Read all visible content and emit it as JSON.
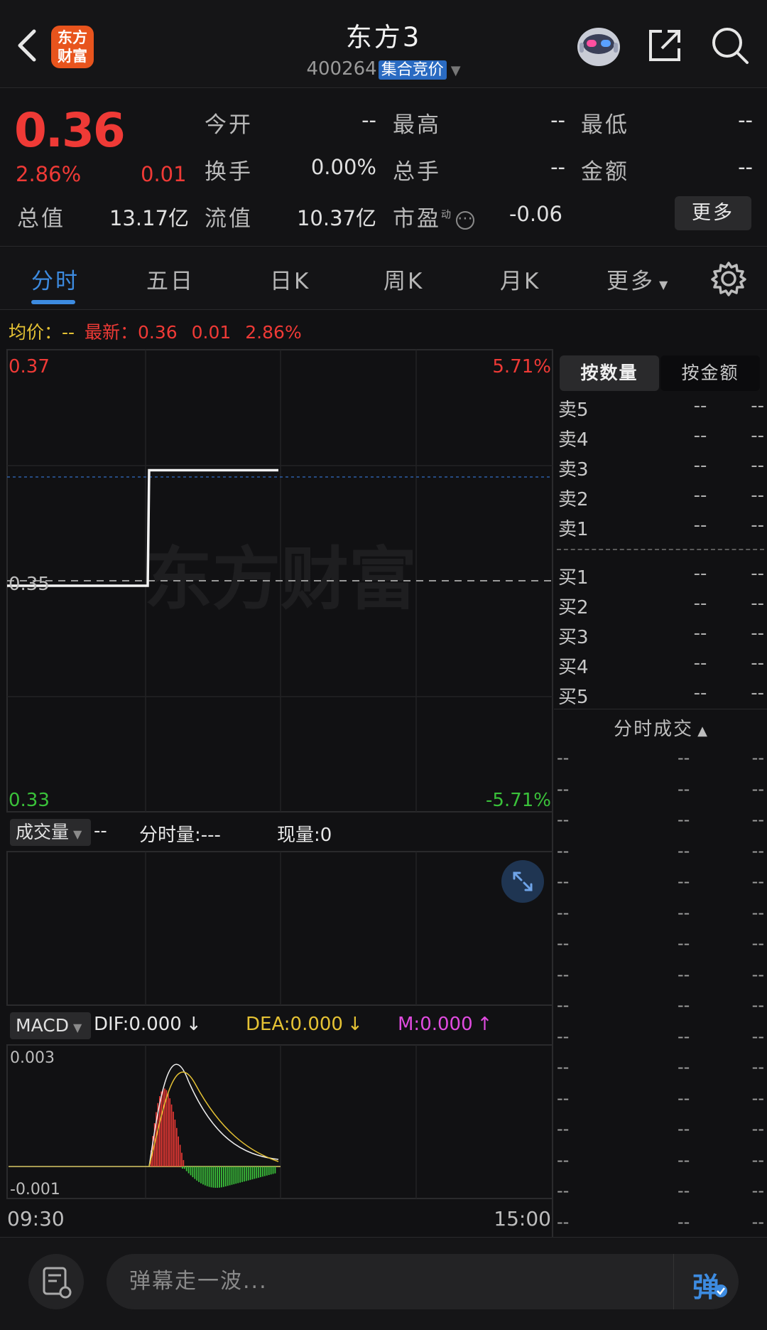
{
  "header": {
    "logo_line1": "东方",
    "logo_line2": "财富",
    "title": "东方3",
    "code": "400264",
    "status_badge": "集合竞价"
  },
  "quote": {
    "price": "0.36",
    "pct": "2.86%",
    "change": "0.01",
    "open_label": "今开",
    "open_value": "--",
    "high_label": "最高",
    "high_value": "--",
    "low_label": "最低",
    "low_value": "--",
    "turnover_label": "换手",
    "turnover_value": "0.00%",
    "volume_label": "总手",
    "volume_value": "--",
    "amount_label": "金额",
    "amount_value": "--",
    "mktcap_label": "总值",
    "mktcap_value": "13.17亿",
    "float_label": "流值",
    "float_value": "10.37亿",
    "pe_label": "市盈",
    "pe_sup": "动",
    "pe_value": "-0.06",
    "more_label": "更多"
  },
  "tabs": [
    {
      "label": "分时",
      "active": true
    },
    {
      "label": "五日",
      "active": false
    },
    {
      "label": "日K",
      "active": false
    },
    {
      "label": "周K",
      "active": false
    },
    {
      "label": "月K",
      "active": false
    },
    {
      "label": "更多",
      "active": false
    }
  ],
  "info_line": {
    "avg_label": "均价：",
    "avg_value": "--",
    "latest_label": "最新：",
    "latest_price": "0.36",
    "latest_change": "0.01",
    "latest_pct": "2.86%"
  },
  "chart": {
    "y_top": "0.37",
    "y_mid": "0.35",
    "y_bottom": "0.33",
    "pct_top": "5.71%",
    "pct_bottom": "-5.71%",
    "watermark": "东方财富",
    "x_start": "09:30",
    "x_end": "15:00"
  },
  "chart_data": {
    "type": "line",
    "ylim": [
      0.33,
      0.37
    ],
    "prev_close": 0.35,
    "x_range": [
      "09:30",
      "15:00"
    ],
    "series": [
      {
        "values": [
          0.35,
          0.35,
          0.36,
          0.36
        ]
      }
    ]
  },
  "volume": {
    "select_label": "成交量",
    "vol_value": "--",
    "period_label": "分时量:",
    "period_value": "---",
    "current_label": "现量:",
    "current_value": "0"
  },
  "macd": {
    "select_label": "MACD",
    "dif": "DIF:0.000",
    "dea": "DEA:0.000",
    "m": "M:0.000",
    "y_top": "0.003",
    "y_bottom": "-0.001"
  },
  "orderbook": {
    "tab_qty": "按数量",
    "tab_amt": "按金额",
    "sell": [
      {
        "label": "卖5",
        "v1": "--",
        "v2": "--"
      },
      {
        "label": "卖4",
        "v1": "--",
        "v2": "--"
      },
      {
        "label": "卖3",
        "v1": "--",
        "v2": "--"
      },
      {
        "label": "卖2",
        "v1": "--",
        "v2": "--"
      },
      {
        "label": "卖1",
        "v1": "--",
        "v2": "--"
      }
    ],
    "buy": [
      {
        "label": "买1",
        "v1": "--",
        "v2": "--"
      },
      {
        "label": "买2",
        "v1": "--",
        "v2": "--"
      },
      {
        "label": "买3",
        "v1": "--",
        "v2": "--"
      },
      {
        "label": "买4",
        "v1": "--",
        "v2": "--"
      },
      {
        "label": "买5",
        "v1": "--",
        "v2": "--"
      }
    ],
    "ticks_title": "分时成交",
    "tick_row": [
      "--",
      "--",
      "--"
    ]
  },
  "bottom": {
    "danmu_placeholder": "弹幕走一波...",
    "danmu_btn": "弹"
  },
  "colors": {
    "up": "#ef3a36",
    "down": "#3ac13a",
    "accent": "#3d8be0",
    "avg": "#e5c234",
    "macd_m": "#e04be0"
  }
}
